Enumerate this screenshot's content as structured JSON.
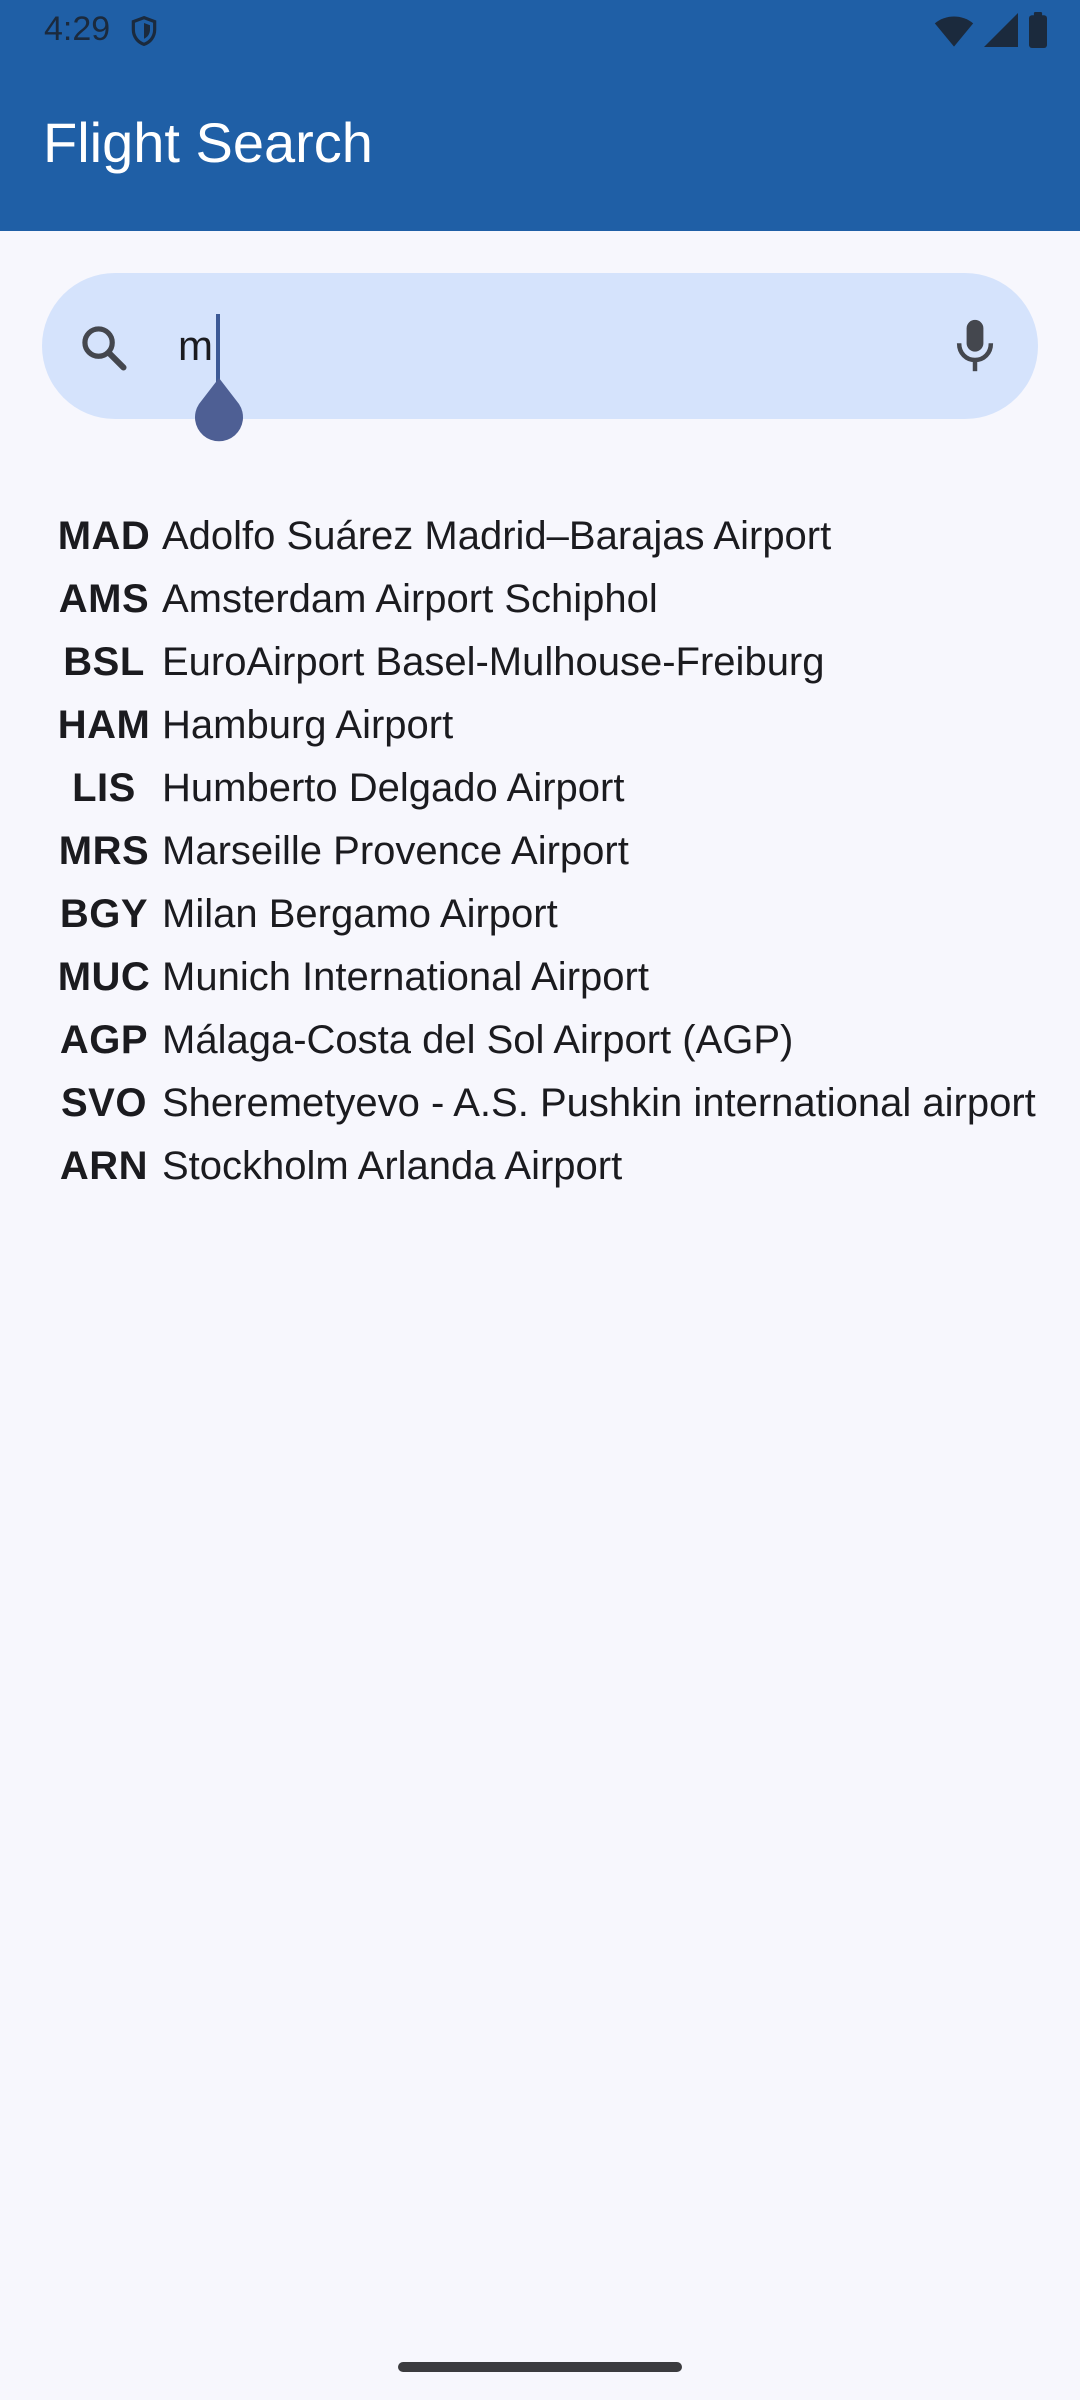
{
  "status_bar": {
    "time": "4:29",
    "icons": [
      "shield-icon",
      "wifi-icon",
      "signal-icon",
      "battery-icon"
    ]
  },
  "app_bar": {
    "title": "Flight Search",
    "color": "#1f5fa6"
  },
  "search": {
    "value": "m",
    "icon": "search-icon",
    "voice_icon": "mic-icon"
  },
  "results": [
    {
      "code": "MAD",
      "name": "Adolfo Suárez Madrid–Barajas Airport"
    },
    {
      "code": "AMS",
      "name": "Amsterdam Airport Schiphol"
    },
    {
      "code": "BSL",
      "name": "EuroAirport Basel-Mulhouse-Freiburg"
    },
    {
      "code": "HAM",
      "name": "Hamburg Airport"
    },
    {
      "code": "LIS",
      "name": "Humberto Delgado Airport"
    },
    {
      "code": "MRS",
      "name": "Marseille Provence Airport"
    },
    {
      "code": "BGY",
      "name": "Milan Bergamo Airport"
    },
    {
      "code": "MUC",
      "name": "Munich International Airport"
    },
    {
      "code": "AGP",
      "name": "Málaga-Costa del Sol Airport (AGP)"
    },
    {
      "code": "SVO",
      "name": "Sheremetyevo - A.S. Pushkin international airport"
    },
    {
      "code": "ARN",
      "name": "Stockholm Arlanda Airport"
    }
  ]
}
